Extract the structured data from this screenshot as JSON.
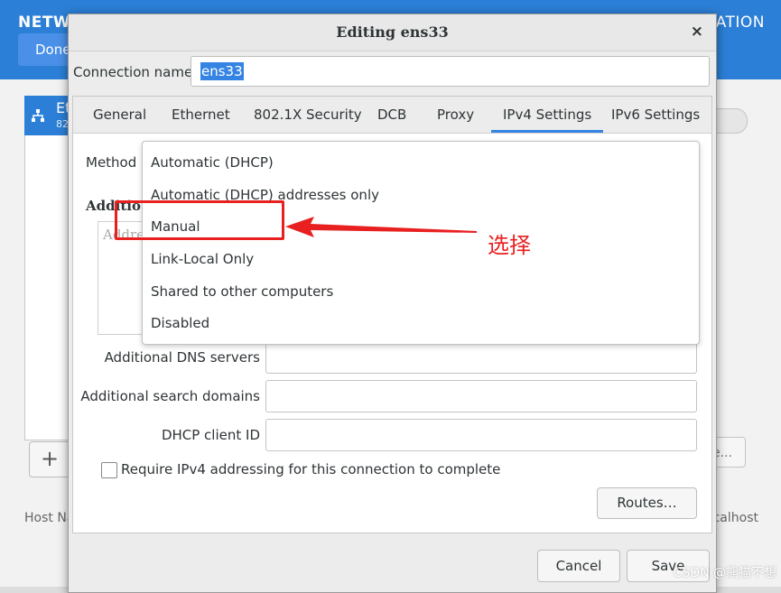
{
  "background": {
    "title_left": "NETW",
    "title_right": "LATION",
    "done_label": "Done",
    "list_item_title": "Et",
    "list_item_sub": "82",
    "add_label": "+",
    "host_name_label": "Host Na",
    "host_value": "calhost",
    "config_label": "e..."
  },
  "dialog": {
    "title": "Editing ens33",
    "close_label": "×",
    "connection_name_label": "Connection name",
    "connection_name_value": "ens33",
    "tabs": [
      {
        "label": "General"
      },
      {
        "label": "Ethernet"
      },
      {
        "label": "802.1X Security"
      },
      {
        "label": "DCB"
      },
      {
        "label": "Proxy"
      },
      {
        "label": "IPv4 Settings",
        "active": true
      },
      {
        "label": "IPv6 Settings"
      }
    ],
    "method_label": "Method",
    "addresses_label": "Additio",
    "addresses_col": "Addre",
    "fields": [
      {
        "label": "Additional DNS servers",
        "value": ""
      },
      {
        "label": "Additional search domains",
        "value": ""
      },
      {
        "label": "DHCP client ID",
        "value": ""
      }
    ],
    "require_ipv4_label": "Require IPv4 addressing for this connection to complete",
    "require_ipv4_checked": false,
    "routes_label": "Routes…",
    "cancel_label": "Cancel",
    "save_label": "Save"
  },
  "method_dropdown": {
    "options": [
      "Automatic (DHCP)",
      "Automatic (DHCP) addresses only",
      "Manual",
      "Link-Local Only",
      "Shared to other computers",
      "Disabled"
    ],
    "highlighted": "Manual"
  },
  "annotation": {
    "text": "选择",
    "color": "#e82020"
  },
  "watermark": "CSDN @熊猫不想",
  "colors": {
    "accent": "#3584e4",
    "header_blue": "#2c7fd6"
  }
}
